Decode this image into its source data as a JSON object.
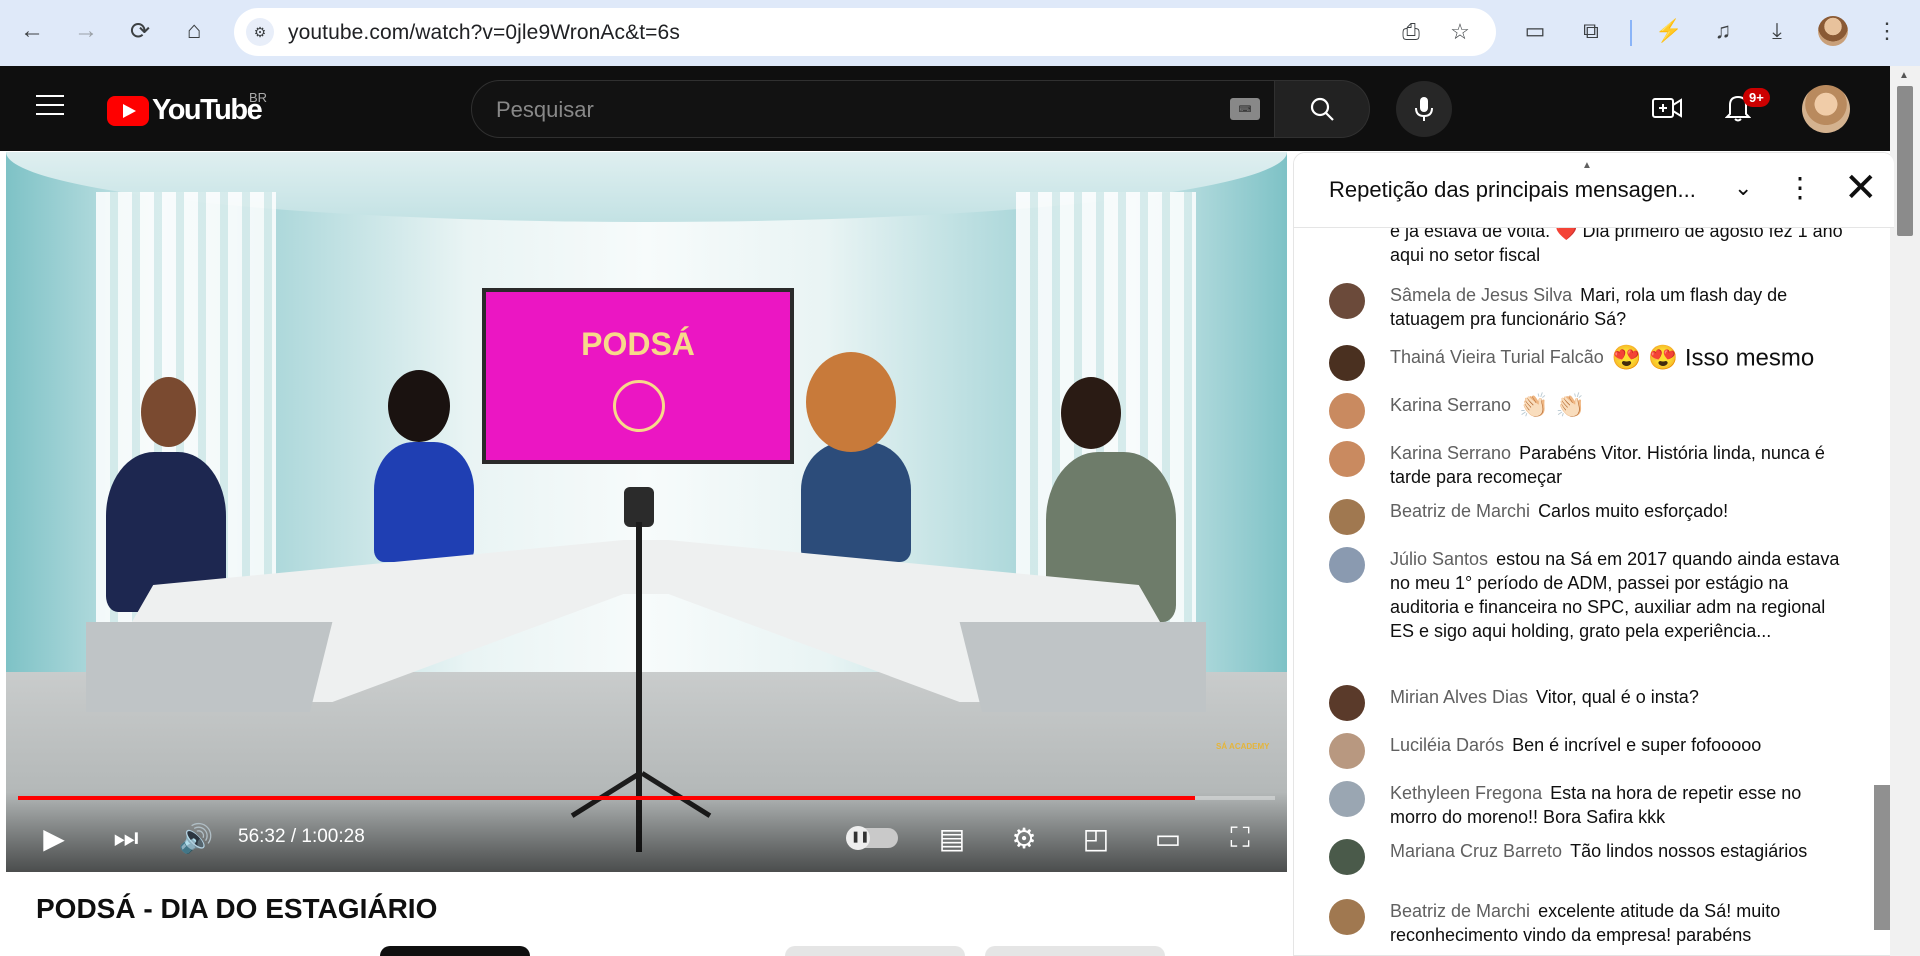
{
  "browser": {
    "url": "youtube.com/watch?v=0jle9WronAc&t=6s"
  },
  "header": {
    "logo_text": "YouTube",
    "country": "BR",
    "search_placeholder": "Pesquisar",
    "notifications_badge": "9+"
  },
  "video": {
    "screen_text": "PODSÁ",
    "time": "56:32 / 1:00:28",
    "progress": 0.936,
    "title": "PODSÁ - DIA DO ESTAGIÁRIO",
    "watermark": "SÁ ACADEMY"
  },
  "chat": {
    "title": "Repetição das principais mensagen...",
    "messages": [
      {
        "author": "",
        "text": "e já estava de volta. ❤️ Dia primeiro de agosto fez 1 ano aqui no setor fiscal"
      },
      {
        "author": "Sâmela de Jesus Silva",
        "text": "Mari, rola um flash day de tatuagem pra funcionário Sá?"
      },
      {
        "author": "Thainá Vieira Turial Falcão",
        "text": "😍 😍 Isso mesmo"
      },
      {
        "author": "Karina Serrano",
        "text": "👏🏻 👏🏻"
      },
      {
        "author": "Karina Serrano",
        "text": "Parabéns Vitor. História linda, nunca é tarde para recomeçar"
      },
      {
        "author": "Beatriz de Marchi",
        "text": "Carlos muito esforçado!"
      },
      {
        "author": "Júlio Santos",
        "text": "estou na Sá em 2017 quando ainda estava no meu 1° período de ADM, passei por estágio na auditoria e financeira no SPC, auxiliar adm na regional ES e sigo aqui holding, grato pela experiência..."
      },
      {
        "author": "Mirian Alves Dias",
        "text": "Vitor, qual é o insta?"
      },
      {
        "author": "Luciléia Darós",
        "text": "Ben é incrível e super fofooooo"
      },
      {
        "author": "Kethyleen Fregona",
        "text": "Esta na hora de repetir esse no morro do moreno!! Bora Safira kkk"
      },
      {
        "author": "Mariana Cruz Barreto",
        "text": "Tão lindos nossos estagiários"
      },
      {
        "author": "Beatriz de Marchi",
        "text": "excelente atitude da Sá! muito reconhecimento vindo da empresa! parabéns"
      }
    ]
  },
  "colors": {
    "youtube_red": "#ff0000",
    "header_bg": "#0f0f0f",
    "chat_author": "#606060"
  }
}
